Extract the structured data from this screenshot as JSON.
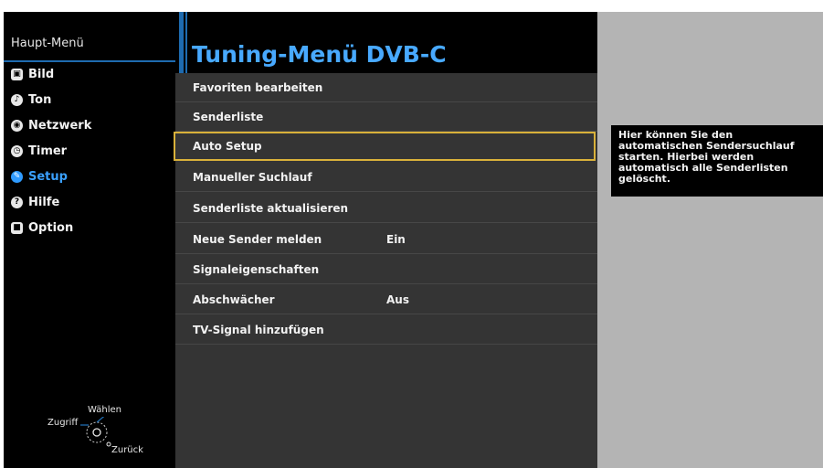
{
  "sidebar": {
    "title": "Haupt-Menü",
    "items": [
      {
        "label": "Bild",
        "icon": "picture-icon",
        "glyph": "▣"
      },
      {
        "label": "Ton",
        "icon": "speaker-icon",
        "glyph": "♪"
      },
      {
        "label": "Netzwerk",
        "icon": "network-icon",
        "glyph": "◉"
      },
      {
        "label": "Timer",
        "icon": "clock-icon",
        "glyph": "◷"
      },
      {
        "label": "Setup",
        "icon": "wrench-icon",
        "glyph": "✎",
        "active": true
      },
      {
        "label": "Hilfe",
        "icon": "help-icon",
        "glyph": "?"
      },
      {
        "label": "Option",
        "icon": "option-icon",
        "glyph": "■"
      }
    ],
    "nav_legend": {
      "select": "Wählen",
      "access": "Zugriff",
      "back": "Zurück"
    }
  },
  "main": {
    "title": "Tuning-Menü DVB-C",
    "rows": [
      {
        "label": "Favoriten bearbeiten",
        "value": ""
      },
      {
        "label": "Senderliste",
        "value": ""
      },
      {
        "label": "Auto Setup",
        "value": "",
        "selected": true
      },
      {
        "label": "Manueller Suchlauf",
        "value": ""
      },
      {
        "label": "Senderliste aktualisieren",
        "value": ""
      },
      {
        "label": "Neue Sender melden",
        "value": "Ein"
      },
      {
        "label": "Signaleigenschaften",
        "value": ""
      },
      {
        "label": "Abschwächer",
        "value": "Aus"
      },
      {
        "label": "TV-Signal hinzufügen",
        "value": ""
      }
    ]
  },
  "info": {
    "text": "Hier können Sie den\nautomatischen Sendersuchlauf\nstarten. Hierbei werden\nautomatisch alle Senderlisten\ngelöscht."
  },
  "colors": {
    "accent_blue": "#1e6bb0",
    "title_blue": "#48a9ff",
    "selection_gold": "#d9b13a",
    "active_item": "#3aa0ff"
  }
}
